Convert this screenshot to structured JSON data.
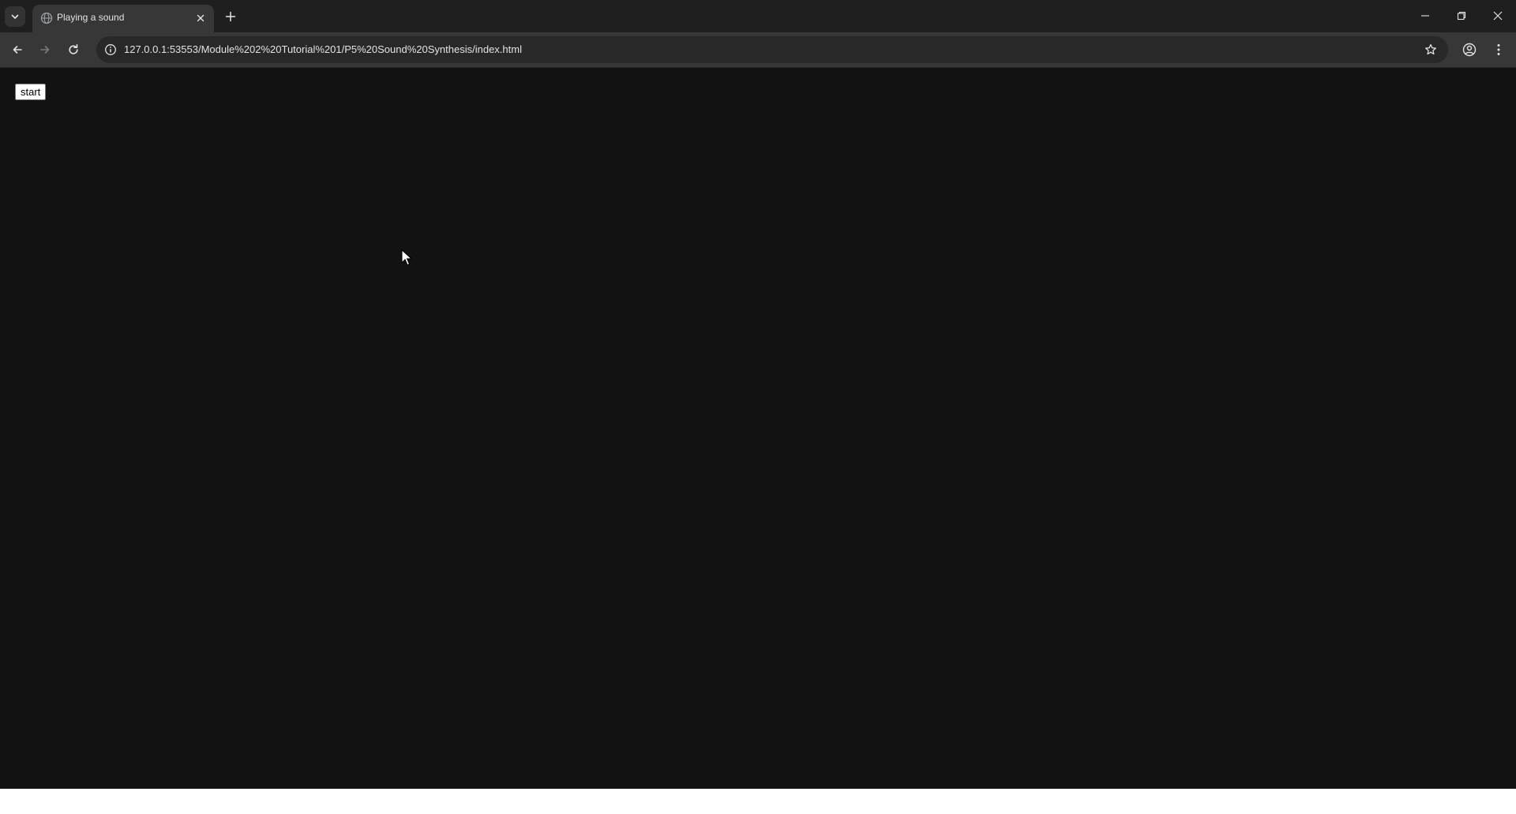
{
  "browser": {
    "tab": {
      "title": "Playing a sound",
      "favicon": "globe-icon"
    },
    "address_bar": {
      "url": "127.0.0.1:53553/Module%202%20Tutorial%201/P5%20Sound%20Synthesis/index.html"
    }
  },
  "page": {
    "start_button_label": "start"
  },
  "colors": {
    "tabstrip_bg": "#1f1f1f",
    "toolbar_bg": "#373737",
    "omnibox_bg": "#282828",
    "page_bg": "#121212",
    "text": "#e3e3e3"
  }
}
